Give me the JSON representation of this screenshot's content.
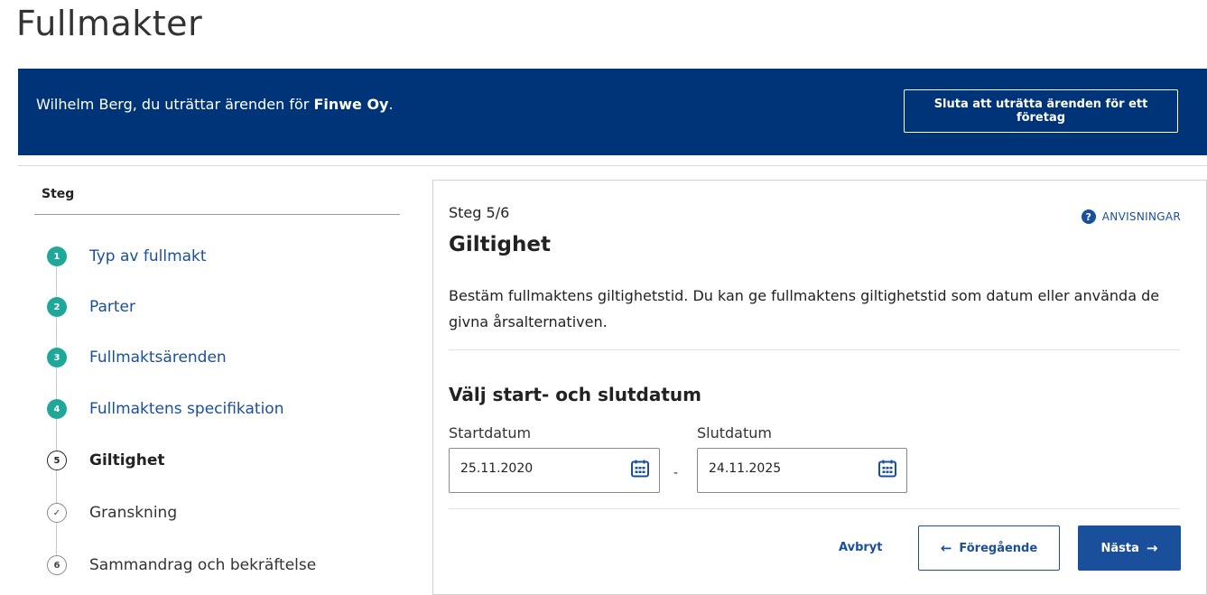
{
  "page": {
    "title": "Fullmakter"
  },
  "banner": {
    "text_prefix": "Wilhelm Berg, du uträttar ärenden för ",
    "company": "Finwe Oy",
    "text_suffix": ".",
    "stop_button_label": "Sluta att uträtta ärenden för ett företag",
    "background_color": "#003479"
  },
  "sidebar": {
    "heading": "Steg",
    "steps": [
      {
        "marker": "1",
        "label": "Typ av fullmakt",
        "state": "done"
      },
      {
        "marker": "2",
        "label": "Parter",
        "state": "done"
      },
      {
        "marker": "3",
        "label": "Fullmaktsärenden",
        "state": "done"
      },
      {
        "marker": "4",
        "label": "Fullmaktens specifikation",
        "state": "done"
      },
      {
        "marker": "5",
        "label": "Giltighet",
        "state": "current"
      },
      {
        "marker": "✓",
        "label": "Granskning",
        "state": "todo"
      },
      {
        "marker": "6",
        "label": "Sammandrag och bekräftelse",
        "state": "todo"
      }
    ],
    "done_color": "#1fa89a"
  },
  "main": {
    "step_counter": "Steg 5/6",
    "help_label": "ANVISNINGAR",
    "help_icon": "question-circle-icon",
    "title": "Giltighet",
    "description": "Bestäm fullmaktens giltighetstid. Du kan ge fullmaktens giltighetstid som datum eller använda de givna årsalternativen.",
    "date_section_title": "Välj start- och slutdatum",
    "start_date": {
      "label": "Startdatum",
      "value": "25.11.2020"
    },
    "end_date": {
      "label": "Slutdatum",
      "value": "24.11.2025"
    },
    "range_separator": "-",
    "calendar_icon": "calendar-icon"
  },
  "actions": {
    "cancel_label": "Avbryt",
    "previous_label": "Föregående",
    "next_label": "Nästa",
    "accent_color": "#1a4f9c"
  }
}
